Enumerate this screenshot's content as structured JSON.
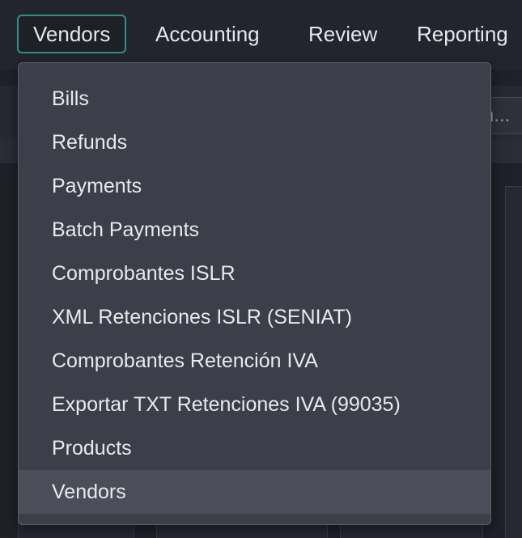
{
  "nav": {
    "items": [
      {
        "label": "Vendors",
        "active": true
      },
      {
        "label": "Accounting",
        "active": false
      },
      {
        "label": "Review",
        "active": false
      },
      {
        "label": "Reporting",
        "active": false
      }
    ]
  },
  "background": {
    "search_text": "n..."
  },
  "dropdown": {
    "items": [
      {
        "label": "Bills"
      },
      {
        "label": "Refunds"
      },
      {
        "label": "Payments"
      },
      {
        "label": "Batch Payments"
      },
      {
        "label": "Comprobantes ISLR"
      },
      {
        "label": "XML Retenciones ISLR (SENIAT)"
      },
      {
        "label": "Comprobantes Retención IVA"
      },
      {
        "label": "Exportar TXT Retenciones IVA (99035)"
      },
      {
        "label": "Products"
      },
      {
        "label": "Vendors",
        "highlighted": true
      }
    ]
  },
  "colors": {
    "accent": "#2f8f86",
    "menu_bg": "#3d3e49",
    "menu_hover": "#4c4d59"
  }
}
